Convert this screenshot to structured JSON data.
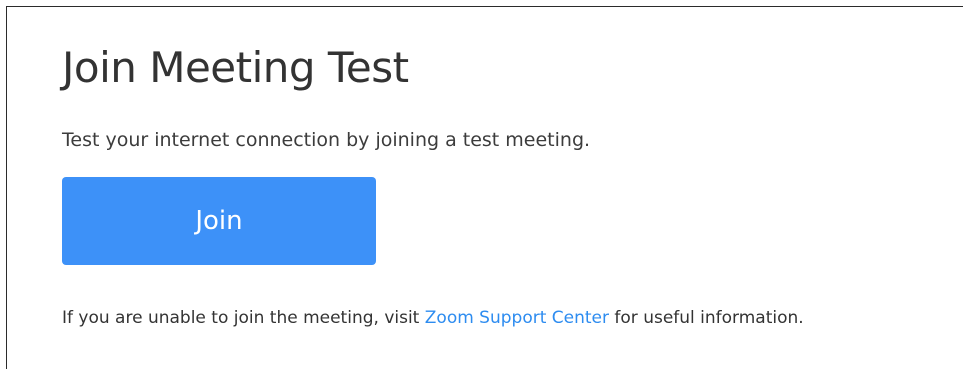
{
  "page": {
    "title": "Join Meeting Test",
    "subtitle": "Test your internet connection by joining a test meeting.",
    "join_button_label": "Join",
    "help": {
      "prefix": "If you are unable to join the meeting, visit ",
      "link_text": "Zoom Support Center",
      "suffix": " for useful information."
    }
  },
  "colors": {
    "accent": "#3d91f8",
    "link": "#2d8cf0",
    "text": "#333333",
    "background": "#ffffff"
  }
}
